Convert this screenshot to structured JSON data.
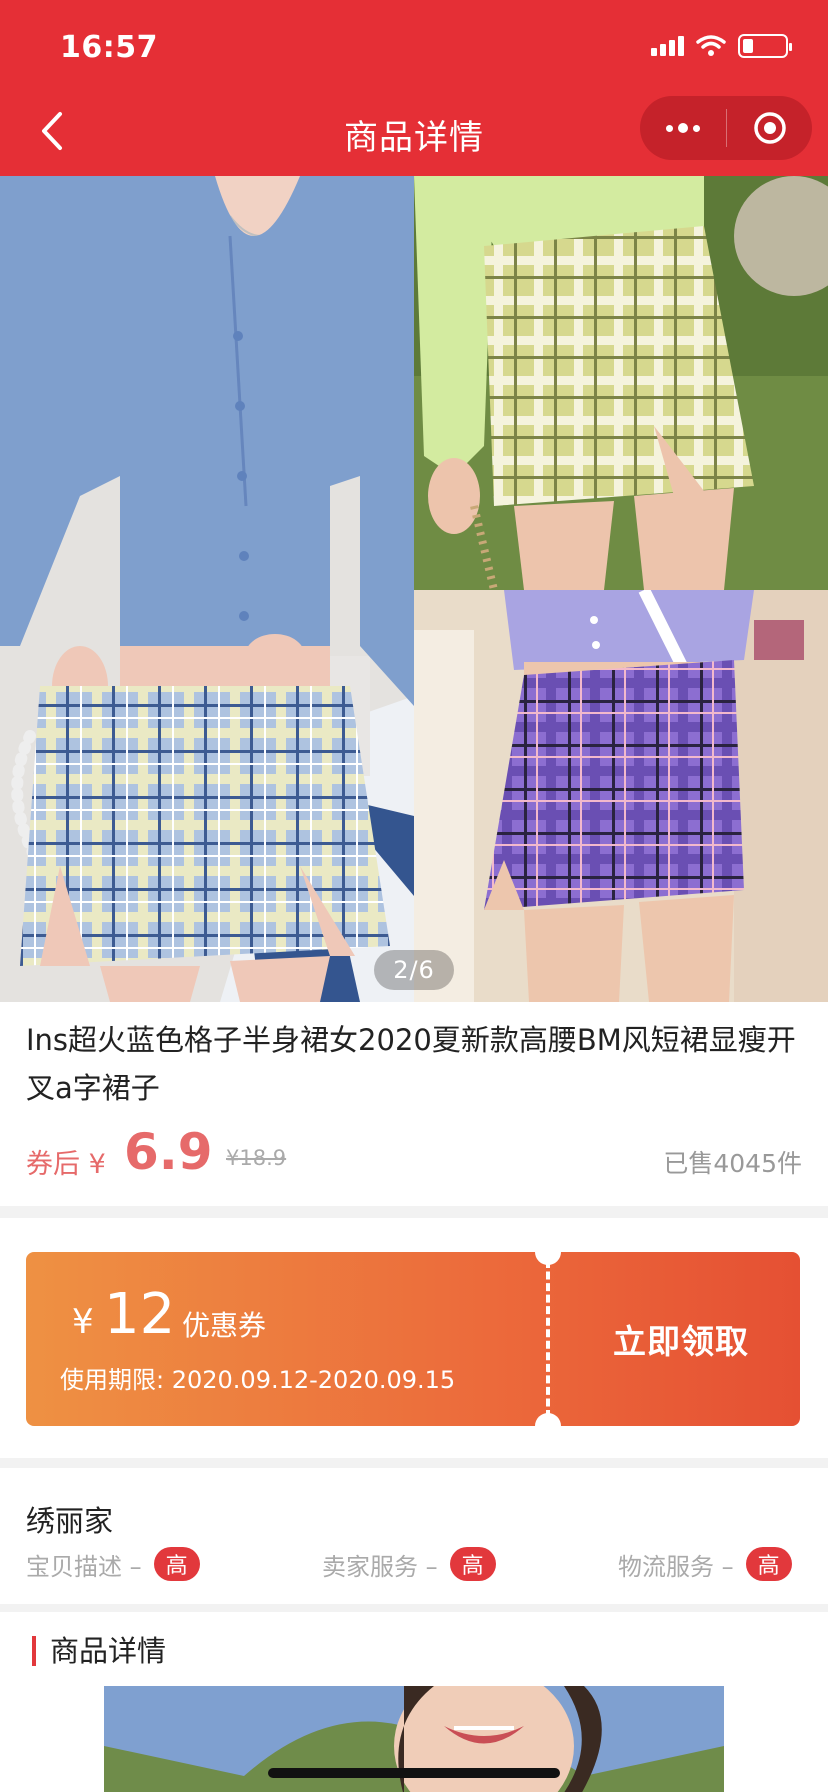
{
  "status_bar": {
    "time": "16:57"
  },
  "nav": {
    "title": "商品详情"
  },
  "gallery": {
    "pager": "2/6"
  },
  "product": {
    "title": "Ins超火蓝色格子半身裙女2020夏新款高腰BM风短裙显瘦开叉a字裙子",
    "price_prefix": "券后 ¥",
    "price": "6.9",
    "original_price": "¥18.9",
    "sold": "已售4045件"
  },
  "coupon": {
    "currency": "¥",
    "amount": "12",
    "label": "优惠券",
    "period": "使用期限: 2020.09.12-2020.09.15",
    "button": "立即领取"
  },
  "shop": {
    "name": "绣丽家",
    "ratings": [
      {
        "label": "宝贝描述 –",
        "level": "高"
      },
      {
        "label": "卖家服务 –",
        "level": "高"
      },
      {
        "label": "物流服务 –",
        "level": "高"
      }
    ]
  },
  "detail": {
    "title": "商品详情"
  },
  "colors": {
    "header_red": "#e52f36",
    "price_red": "#e66a6a",
    "coupon_start": "#ee9143",
    "coupon_end": "#e55033",
    "badge_red": "#e2383c"
  }
}
